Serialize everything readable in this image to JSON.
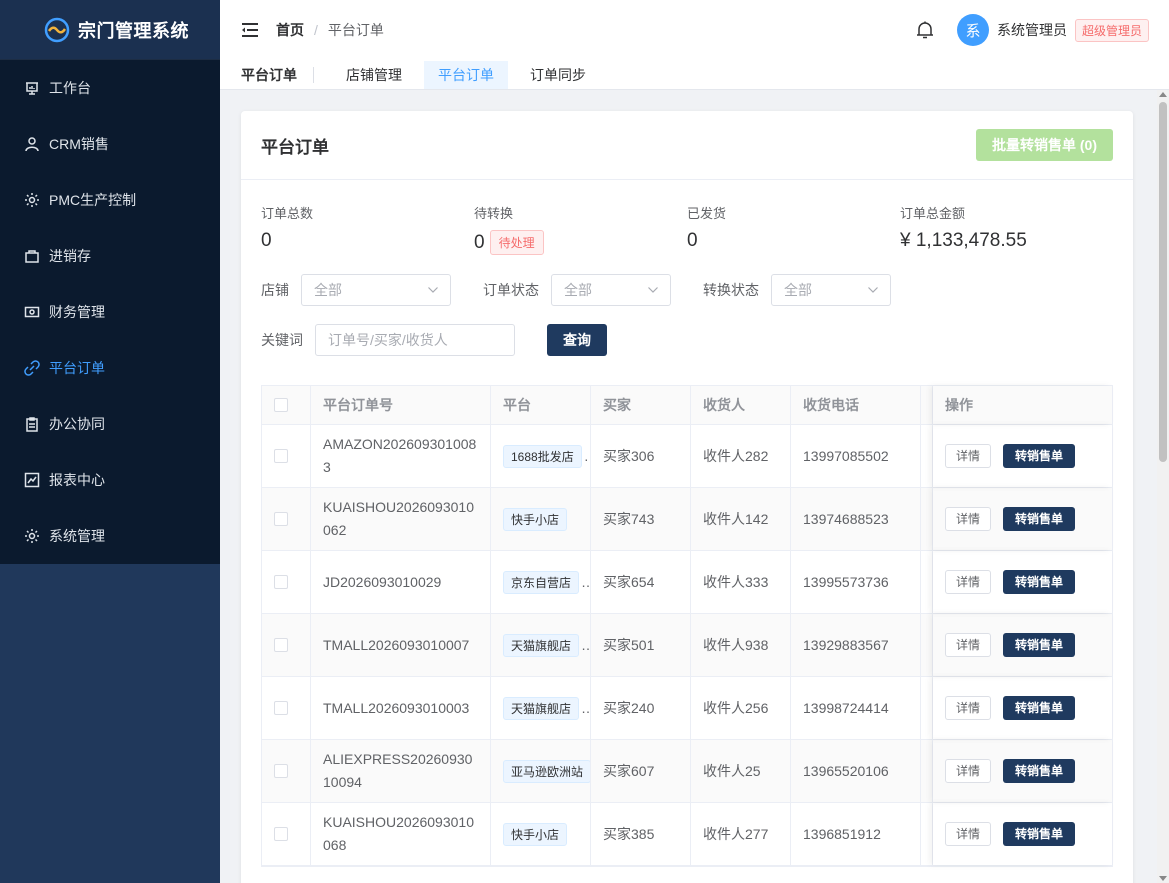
{
  "app": {
    "title": "宗门管理系统"
  },
  "sidebar": {
    "items": [
      {
        "label": "工作台",
        "icon": "presentation-icon",
        "active": false
      },
      {
        "label": "CRM销售",
        "icon": "user-icon",
        "active": false
      },
      {
        "label": "PMC生产控制",
        "icon": "gear-icon",
        "active": false
      },
      {
        "label": "进销存",
        "icon": "bag-icon",
        "active": false
      },
      {
        "label": "财务管理",
        "icon": "money-icon",
        "active": false
      },
      {
        "label": "平台订单",
        "icon": "link-icon",
        "active": true
      },
      {
        "label": "办公协同",
        "icon": "clipboard-icon",
        "active": false
      },
      {
        "label": "报表中心",
        "icon": "chart-icon",
        "active": false
      },
      {
        "label": "系统管理",
        "icon": "gear-icon",
        "active": false
      }
    ]
  },
  "header": {
    "breadcrumb_home": "首页",
    "breadcrumb_sep": "/",
    "breadcrumb_current": "平台订单",
    "avatar_char": "系",
    "user_name": "系统管理员",
    "role": "超级管理员"
  },
  "tabs": {
    "title": "平台订单",
    "items": [
      {
        "label": "店铺管理",
        "active": false
      },
      {
        "label": "平台订单",
        "active": true
      },
      {
        "label": "订单同步",
        "active": false
      }
    ]
  },
  "card": {
    "title": "平台订单",
    "batch_button": "批量转销售单 (0)"
  },
  "stats": [
    {
      "label": "订单总数",
      "value": "0"
    },
    {
      "label": "待转换",
      "value": "0",
      "tag": "待处理"
    },
    {
      "label": "已发货",
      "value": "0"
    },
    {
      "label": "订单总金额",
      "value": "¥ 1,133,478.55"
    }
  ],
  "filters": {
    "shop_label": "店铺",
    "shop_value": "全部",
    "status_label": "订单状态",
    "status_value": "全部",
    "convert_label": "转换状态",
    "convert_value": "全部",
    "keyword_label": "关键词",
    "keyword_placeholder": "订单号/买家/收货人",
    "query_button": "查询"
  },
  "table": {
    "headers": {
      "order_no": "平台订单号",
      "platform": "平台",
      "buyer": "买家",
      "receiver": "收货人",
      "phone": "收货电话",
      "ops": "操作"
    },
    "detail_label": "详情",
    "convert_label": "转销售单",
    "rows": [
      {
        "order_no": "AMAZON2026093010083",
        "platform": "1688批发店",
        "more": "…",
        "buyer": "买家306",
        "receiver": "收件人282",
        "phone": "13997085502"
      },
      {
        "order_no": "KUAISHOU2026093010062",
        "platform": "快手小店",
        "more": "",
        "buyer": "买家743",
        "receiver": "收件人142",
        "phone": "13974688523"
      },
      {
        "order_no": "JD2026093010029",
        "platform": "京东自营店",
        "more": "…",
        "buyer": "买家654",
        "receiver": "收件人333",
        "phone": "13995573736"
      },
      {
        "order_no": "TMALL2026093010007",
        "platform": "天猫旗舰店",
        "more": "…",
        "buyer": "买家501",
        "receiver": "收件人938",
        "phone": "13929883567"
      },
      {
        "order_no": "TMALL2026093010003",
        "platform": "天猫旗舰店",
        "more": "…",
        "buyer": "买家240",
        "receiver": "收件人256",
        "phone": "13998724414"
      },
      {
        "order_no": "ALIEXPRESS2026093010094",
        "platform": "亚马逊欧洲站",
        "more": "",
        "buyer": "买家607",
        "receiver": "收件人25",
        "phone": "13965520106"
      },
      {
        "order_no": "KUAISHOU2026093010068",
        "platform": "快手小店",
        "more": "",
        "buyer": "买家385",
        "receiver": "收件人277",
        "phone": "1396851912"
      }
    ]
  },
  "colors": {
    "accent": "#409eff",
    "sidebar": "#0b1a2e",
    "primary_btn": "#1f3a5f",
    "disabled_btn": "#b3e19d"
  }
}
